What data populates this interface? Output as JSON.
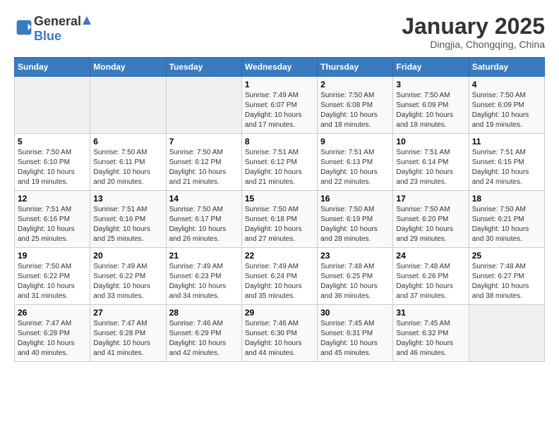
{
  "header": {
    "logo_general": "General",
    "logo_blue": "Blue",
    "title": "January 2025",
    "subtitle": "Dingjia, Chongqing, China"
  },
  "days_of_week": [
    "Sunday",
    "Monday",
    "Tuesday",
    "Wednesday",
    "Thursday",
    "Friday",
    "Saturday"
  ],
  "weeks": [
    [
      {
        "day": "",
        "info": ""
      },
      {
        "day": "",
        "info": ""
      },
      {
        "day": "",
        "info": ""
      },
      {
        "day": "1",
        "info": "Sunrise: 7:49 AM\nSunset: 6:07 PM\nDaylight: 10 hours and 17 minutes."
      },
      {
        "day": "2",
        "info": "Sunrise: 7:50 AM\nSunset: 6:08 PM\nDaylight: 10 hours and 18 minutes."
      },
      {
        "day": "3",
        "info": "Sunrise: 7:50 AM\nSunset: 6:09 PM\nDaylight: 10 hours and 18 minutes."
      },
      {
        "day": "4",
        "info": "Sunrise: 7:50 AM\nSunset: 6:09 PM\nDaylight: 10 hours and 19 minutes."
      }
    ],
    [
      {
        "day": "5",
        "info": "Sunrise: 7:50 AM\nSunset: 6:10 PM\nDaylight: 10 hours and 19 minutes."
      },
      {
        "day": "6",
        "info": "Sunrise: 7:50 AM\nSunset: 6:11 PM\nDaylight: 10 hours and 20 minutes."
      },
      {
        "day": "7",
        "info": "Sunrise: 7:50 AM\nSunset: 6:12 PM\nDaylight: 10 hours and 21 minutes."
      },
      {
        "day": "8",
        "info": "Sunrise: 7:51 AM\nSunset: 6:12 PM\nDaylight: 10 hours and 21 minutes."
      },
      {
        "day": "9",
        "info": "Sunrise: 7:51 AM\nSunset: 6:13 PM\nDaylight: 10 hours and 22 minutes."
      },
      {
        "day": "10",
        "info": "Sunrise: 7:51 AM\nSunset: 6:14 PM\nDaylight: 10 hours and 23 minutes."
      },
      {
        "day": "11",
        "info": "Sunrise: 7:51 AM\nSunset: 6:15 PM\nDaylight: 10 hours and 24 minutes."
      }
    ],
    [
      {
        "day": "12",
        "info": "Sunrise: 7:51 AM\nSunset: 6:16 PM\nDaylight: 10 hours and 25 minutes."
      },
      {
        "day": "13",
        "info": "Sunrise: 7:51 AM\nSunset: 6:16 PM\nDaylight: 10 hours and 25 minutes."
      },
      {
        "day": "14",
        "info": "Sunrise: 7:50 AM\nSunset: 6:17 PM\nDaylight: 10 hours and 26 minutes."
      },
      {
        "day": "15",
        "info": "Sunrise: 7:50 AM\nSunset: 6:18 PM\nDaylight: 10 hours and 27 minutes."
      },
      {
        "day": "16",
        "info": "Sunrise: 7:50 AM\nSunset: 6:19 PM\nDaylight: 10 hours and 28 minutes."
      },
      {
        "day": "17",
        "info": "Sunrise: 7:50 AM\nSunset: 6:20 PM\nDaylight: 10 hours and 29 minutes."
      },
      {
        "day": "18",
        "info": "Sunrise: 7:50 AM\nSunset: 6:21 PM\nDaylight: 10 hours and 30 minutes."
      }
    ],
    [
      {
        "day": "19",
        "info": "Sunrise: 7:50 AM\nSunset: 6:22 PM\nDaylight: 10 hours and 31 minutes."
      },
      {
        "day": "20",
        "info": "Sunrise: 7:49 AM\nSunset: 6:22 PM\nDaylight: 10 hours and 33 minutes."
      },
      {
        "day": "21",
        "info": "Sunrise: 7:49 AM\nSunset: 6:23 PM\nDaylight: 10 hours and 34 minutes."
      },
      {
        "day": "22",
        "info": "Sunrise: 7:49 AM\nSunset: 6:24 PM\nDaylight: 10 hours and 35 minutes."
      },
      {
        "day": "23",
        "info": "Sunrise: 7:48 AM\nSunset: 6:25 PM\nDaylight: 10 hours and 36 minutes."
      },
      {
        "day": "24",
        "info": "Sunrise: 7:48 AM\nSunset: 6:26 PM\nDaylight: 10 hours and 37 minutes."
      },
      {
        "day": "25",
        "info": "Sunrise: 7:48 AM\nSunset: 6:27 PM\nDaylight: 10 hours and 38 minutes."
      }
    ],
    [
      {
        "day": "26",
        "info": "Sunrise: 7:47 AM\nSunset: 6:28 PM\nDaylight: 10 hours and 40 minutes."
      },
      {
        "day": "27",
        "info": "Sunrise: 7:47 AM\nSunset: 6:28 PM\nDaylight: 10 hours and 41 minutes."
      },
      {
        "day": "28",
        "info": "Sunrise: 7:46 AM\nSunset: 6:29 PM\nDaylight: 10 hours and 42 minutes."
      },
      {
        "day": "29",
        "info": "Sunrise: 7:46 AM\nSunset: 6:30 PM\nDaylight: 10 hours and 44 minutes."
      },
      {
        "day": "30",
        "info": "Sunrise: 7:45 AM\nSunset: 6:31 PM\nDaylight: 10 hours and 45 minutes."
      },
      {
        "day": "31",
        "info": "Sunrise: 7:45 AM\nSunset: 6:32 PM\nDaylight: 10 hours and 46 minutes."
      },
      {
        "day": "",
        "info": ""
      }
    ]
  ]
}
